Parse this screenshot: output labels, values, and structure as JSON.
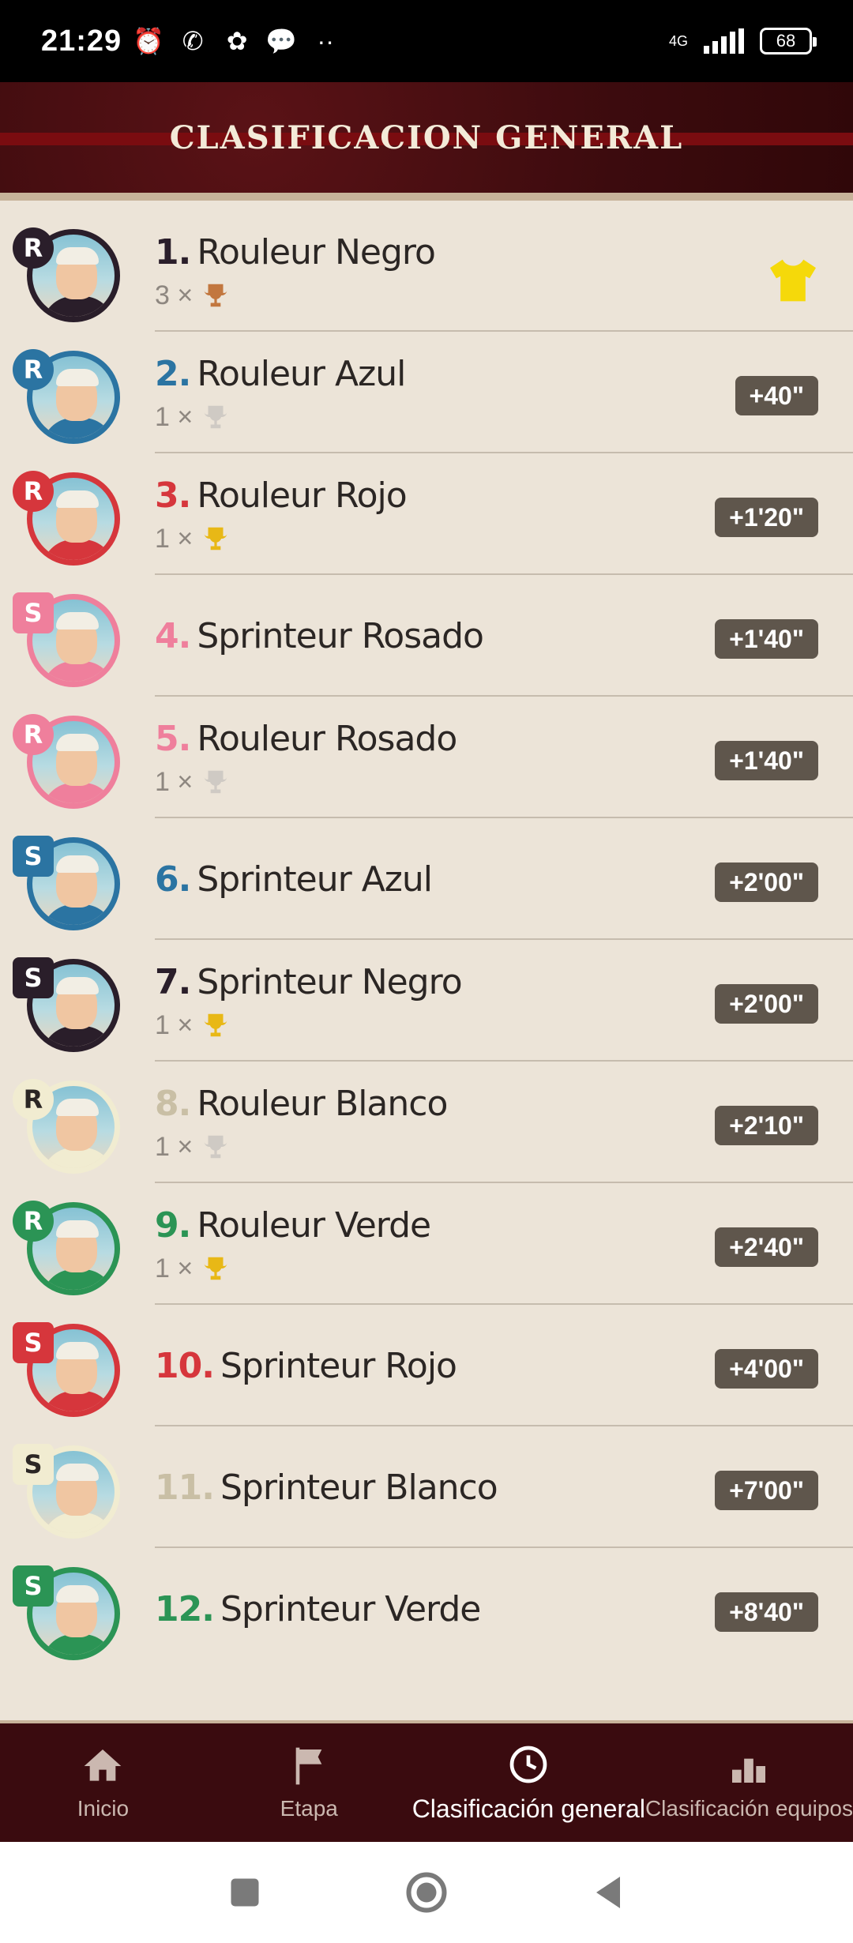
{
  "status_bar": {
    "time": "21:29",
    "network": "4G",
    "battery": "68",
    "icons": [
      "alarm-icon",
      "whatsapp-icon",
      "app-icon",
      "chat-icon",
      "more-dots-icon"
    ]
  },
  "header": {
    "title": "CLASIFICACION GENERAL"
  },
  "colors": {
    "negro": "#2a1e2a",
    "azul": "#2b74a2",
    "rojo": "#d6363c",
    "rosado": "#ef7f9c",
    "blanco": "#f1ecd1",
    "verde": "#2b9455",
    "jersey": "#f5d90a",
    "gap_badge": "#5f564c"
  },
  "rows": [
    {
      "pos": "1.",
      "name": "Rouleur Negro",
      "type": "R",
      "team": "negro",
      "wins": "3 ×",
      "trophy": "bronze",
      "gap": "",
      "leader": true
    },
    {
      "pos": "2.",
      "name": "Rouleur Azul",
      "type": "R",
      "team": "azul",
      "wins": "1 ×",
      "trophy": "silver",
      "gap": "+40\""
    },
    {
      "pos": "3.",
      "name": "Rouleur Rojo",
      "type": "R",
      "team": "rojo",
      "wins": "1 ×",
      "trophy": "gold",
      "gap": "+1'20\""
    },
    {
      "pos": "4.",
      "name": "Sprinteur Rosado",
      "type": "S",
      "team": "rosado",
      "wins": "",
      "trophy": "",
      "gap": "+1'40\""
    },
    {
      "pos": "5.",
      "name": "Rouleur Rosado",
      "type": "R",
      "team": "rosado",
      "wins": "1 ×",
      "trophy": "silver",
      "gap": "+1'40\""
    },
    {
      "pos": "6.",
      "name": "Sprinteur Azul",
      "type": "S",
      "team": "azul",
      "wins": "",
      "trophy": "",
      "gap": "+2'00\""
    },
    {
      "pos": "7.",
      "name": "Sprinteur Negro",
      "type": "S",
      "team": "negro",
      "wins": "1 ×",
      "trophy": "gold",
      "gap": "+2'00\""
    },
    {
      "pos": "8.",
      "name": "Rouleur Blanco",
      "type": "R",
      "team": "blanco",
      "wins": "1 ×",
      "trophy": "silver",
      "gap": "+2'10\""
    },
    {
      "pos": "9.",
      "name": "Rouleur Verde",
      "type": "R",
      "team": "verde",
      "wins": "1 ×",
      "trophy": "gold",
      "gap": "+2'40\""
    },
    {
      "pos": "10.",
      "name": "Sprinteur Rojo",
      "type": "S",
      "team": "rojo",
      "wins": "",
      "trophy": "",
      "gap": "+4'00\""
    },
    {
      "pos": "11.",
      "name": "Sprinteur Blanco",
      "type": "S",
      "team": "blanco",
      "wins": "",
      "trophy": "",
      "gap": "+7'00\""
    },
    {
      "pos": "12.",
      "name": "Sprinteur Verde",
      "type": "S",
      "team": "verde",
      "wins": "",
      "trophy": "",
      "gap": "+8'40\""
    }
  ],
  "bottom_nav": [
    {
      "label": "Inicio",
      "icon": "home-icon"
    },
    {
      "label": "Etapa",
      "icon": "flag-icon"
    },
    {
      "label": "Clasificación general",
      "icon": "clock-icon",
      "active": true
    },
    {
      "label": "Clasificación equipos",
      "icon": "podium-icon"
    }
  ],
  "system_nav": [
    "recents-icon",
    "home-circle-icon",
    "back-icon"
  ]
}
